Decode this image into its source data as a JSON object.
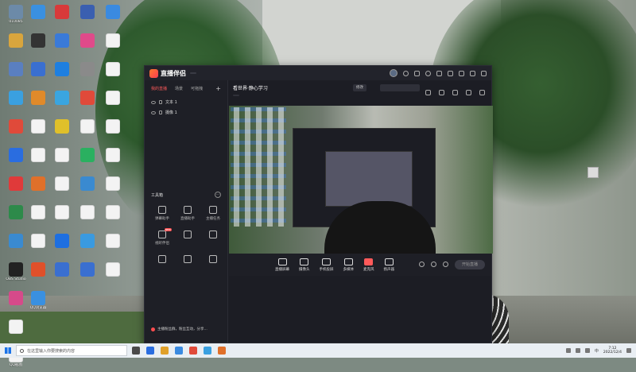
{
  "desktop": {
    "col1": [
      {
        "label": "010085",
        "color": "#6c8aa8",
        "kind": "app"
      },
      {
        "label": "",
        "color": "#d9a53d",
        "kind": "app"
      },
      {
        "label": "",
        "color": "#5a7fc0",
        "kind": "app"
      },
      {
        "label": "",
        "color": "#3aa0e0",
        "kind": "app"
      },
      {
        "label": "",
        "color": "#e04a3a",
        "kind": "app"
      },
      {
        "label": "",
        "color": "#2a6de0",
        "kind": "app"
      },
      {
        "label": "",
        "color": "#e03a3a",
        "kind": "app"
      },
      {
        "label": "",
        "color": "#2d8a4a",
        "kind": "app"
      },
      {
        "label": "",
        "color": "#3a8ad0",
        "kind": "app"
      },
      {
        "label": "OBS Studio",
        "color": "#222222",
        "kind": "app"
      },
      {
        "label": "",
        "color": "#d64a8a",
        "kind": "app"
      },
      {
        "label": "",
        "color": "#f4f4f4",
        "kind": "doc"
      },
      {
        "label": "QQ截图",
        "color": "#f4f4f4",
        "kind": "doc"
      }
    ],
    "col2": [
      {
        "label": "",
        "color": "#3a90e0",
        "kind": "app"
      },
      {
        "label": "",
        "color": "#333333",
        "kind": "app"
      },
      {
        "label": "",
        "color": "#3a6fd0",
        "kind": "app"
      },
      {
        "label": "",
        "color": "#e08a2a",
        "kind": "app"
      },
      {
        "label": "",
        "color": "#f4f4f4",
        "kind": "doc"
      },
      {
        "label": "",
        "color": "#f4f4f4",
        "kind": "doc"
      },
      {
        "label": "",
        "color": "#e0702a",
        "kind": "app"
      },
      {
        "label": "",
        "color": "#f4f4f4",
        "kind": "doc"
      },
      {
        "label": "",
        "color": "#f4f4f4",
        "kind": "doc"
      },
      {
        "label": "",
        "color": "#e0502a",
        "kind": "app"
      },
      {
        "label": "QQ浏览器",
        "color": "#3a90e0",
        "kind": "app"
      }
    ],
    "col3": [
      {
        "label": "",
        "color": "#d83a3a",
        "kind": "app"
      },
      {
        "label": "",
        "color": "#3a7ad8",
        "kind": "app"
      },
      {
        "label": "",
        "color": "#1e7fe0",
        "kind": "app"
      },
      {
        "label": "",
        "color": "#3aa5e0",
        "kind": "app"
      },
      {
        "label": "",
        "color": "#e0c02a",
        "kind": "app"
      },
      {
        "label": "",
        "color": "#f4f4f4",
        "kind": "doc"
      },
      {
        "label": "",
        "color": "#f4f4f4",
        "kind": "doc"
      },
      {
        "label": "",
        "color": "#f4f4f4",
        "kind": "doc"
      },
      {
        "label": "",
        "color": "#1e6fe0",
        "kind": "app"
      },
      {
        "label": "",
        "color": "#3a6fd0",
        "kind": "app"
      }
    ],
    "col4": [
      {
        "label": "",
        "color": "#3a5fb0",
        "kind": "app"
      },
      {
        "label": "",
        "color": "#e04a8a",
        "kind": "app"
      },
      {
        "label": "",
        "color": "#8a8a8a",
        "kind": "app"
      },
      {
        "label": "",
        "color": "#e04a3a",
        "kind": "app"
      },
      {
        "label": "",
        "color": "#f4f4f4",
        "kind": "doc"
      },
      {
        "label": "",
        "color": "#2ab060",
        "kind": "app"
      },
      {
        "label": "",
        "color": "#3a8ad0",
        "kind": "app"
      },
      {
        "label": "",
        "color": "#f4f4f4",
        "kind": "doc"
      },
      {
        "label": "",
        "color": "#3a9ae0",
        "kind": "app"
      },
      {
        "label": "",
        "color": "#3a6fd0",
        "kind": "app"
      }
    ],
    "col5": [
      {
        "label": "",
        "color": "#3a8ae0",
        "kind": "app"
      },
      {
        "label": "",
        "color": "#f4f4f4",
        "kind": "doc"
      },
      {
        "label": "",
        "color": "#f4f4f4",
        "kind": "doc"
      },
      {
        "label": "",
        "color": "#f4f4f4",
        "kind": "doc"
      },
      {
        "label": "",
        "color": "#f4f4f4",
        "kind": "doc"
      },
      {
        "label": "",
        "color": "#f4f4f4",
        "kind": "doc"
      },
      {
        "label": "",
        "color": "#f4f4f4",
        "kind": "doc"
      },
      {
        "label": "",
        "color": "#f4f4f4",
        "kind": "doc"
      },
      {
        "label": "",
        "color": "#f4f4f4",
        "kind": "doc"
      },
      {
        "label": "",
        "color": "#f4f4f4",
        "kind": "doc"
      }
    ]
  },
  "app": {
    "name": "直播伴侣",
    "version": "",
    "accent": "#ff5a5a",
    "scene_tabs": [
      "我的直播",
      "场景",
      "可拖拽"
    ],
    "sources": [
      "文本 1",
      "摄像 1"
    ],
    "tools_title": "工具箱",
    "tools": [
      {
        "label": "弹幕助手",
        "icon": "barrage-icon"
      },
      {
        "label": "直播助手",
        "icon": "person-icon"
      },
      {
        "label": "主播任务",
        "icon": "task-icon"
      },
      {
        "label": "视听伴侣",
        "icon": "media-icon",
        "new": "NEW"
      },
      {
        "label": "",
        "icon": "download-icon"
      },
      {
        "label": "",
        "icon": "clock-icon"
      },
      {
        "label": "",
        "icon": "screen-icon"
      },
      {
        "label": "",
        "icon": "download2-icon"
      },
      {
        "label": "",
        "icon": "window-icon"
      }
    ],
    "room_title": "看世界·静心学习",
    "title_pill": "修改",
    "category_pill": "",
    "row2": [
      "",
      "",
      "",
      ""
    ],
    "toolbar": [
      {
        "label": "直播屏幕",
        "icon": "screen-share-icon"
      },
      {
        "label": "摄像头",
        "icon": "camera-icon"
      },
      {
        "label": "手机投屏",
        "icon": "phone-cast-icon"
      },
      {
        "label": "多媒体",
        "icon": "media-icon"
      },
      {
        "label": "麦克风",
        "icon": "mic-icon",
        "red": true
      },
      {
        "label": "扬声器",
        "icon": "speaker-icon"
      }
    ],
    "go_live": "开始直播",
    "notice": "主播粉丝群，粉丝互动，分享...",
    "status": [
      "",
      "",
      "",
      "",
      ""
    ]
  },
  "taskbar": {
    "search_placeholder": "在这里输入你要搜索的内容",
    "apps": [
      "#4a4a4a",
      "#2a6de0",
      "#e0a02a",
      "#3a8ae0",
      "#e04a3a",
      "#3aa0e0",
      "#e0702a"
    ],
    "clock_time": "7:12",
    "clock_date": "2022/12/4"
  },
  "stray_icon_label": ""
}
